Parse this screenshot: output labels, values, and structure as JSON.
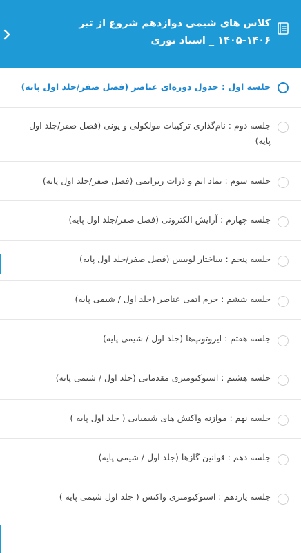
{
  "header": {
    "title": "کلاس های شیمی دوازدهم شروع از تیر ۱۴۰۶-۱۴۰۵ _ استاد نوری",
    "background_color": "#1e9bd7",
    "icons": [
      "book-icon",
      "chevron-right-icon"
    ]
  },
  "accent_color": "#1e87d0",
  "lessons": [
    {
      "label": "جلسه اول : جدول دوره‌ای عناصر (فصل صفر/جلد اول پایه)",
      "selected": true
    },
    {
      "label": "جلسه دوم : نام‌گذاری ترکیبات مولکولی و یونی (فصل صفر/جلد اول پایه)",
      "selected": false
    },
    {
      "label": "جلسه سوم : نماد اتم و ذرات زیراتمی (فصل صفر/جلد اول پایه)",
      "selected": false
    },
    {
      "label": "جلسه چهارم : آرایش الکترونی (فصل صفر/جلد اول پایه)",
      "selected": false
    },
    {
      "label": "جلسه پنجم : ساختار لوییس (فصل صفر/جلد اول پایه)",
      "selected": false
    },
    {
      "label": "جلسه ششم : جرم اتمی عناصر (جلد اول / شیمی پایه)",
      "selected": false
    },
    {
      "label": "جلسه هفتم : ایزوتوپ‌ها (جلد اول / شیمی پایه)",
      "selected": false
    },
    {
      "label": "جلسه هشتم : استوکیومتری مقدماتی (جلد اول / شیمی پایه)",
      "selected": false
    },
    {
      "label": "جلسه نهم : موازنه واکنش های شیمیایی ( جلد اول پایه )",
      "selected": false
    },
    {
      "label": "جلسه دهم : قوانین گازها (جلد اول / شیمی پایه)",
      "selected": false
    },
    {
      "label": "جلسه یازدهم : استوکیومتری واکنش ( جلد اول شیمی پایه )",
      "selected": false
    }
  ]
}
